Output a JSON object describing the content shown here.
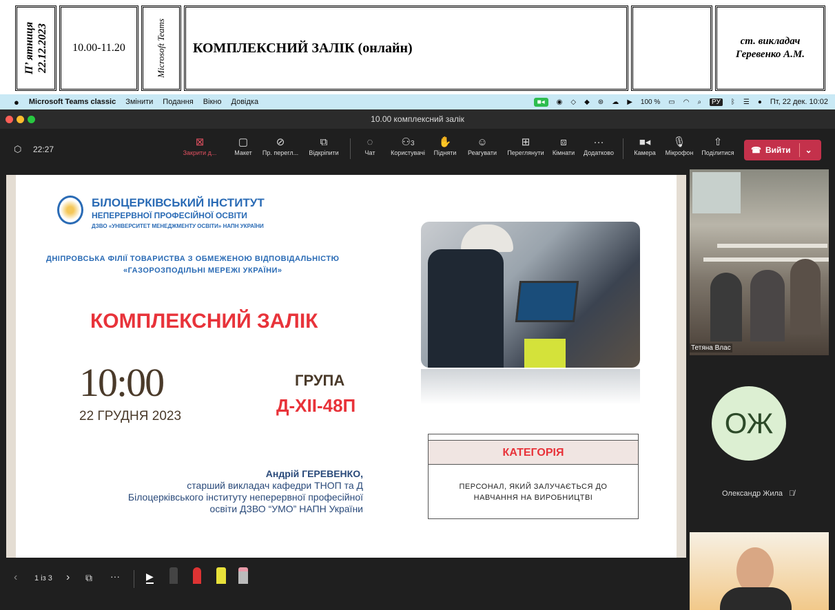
{
  "schedule": {
    "day": "П’ ятниця",
    "date": "22.12.2023",
    "time": "10.00-11.20",
    "platform": "Microsoft Teams",
    "subject": "КОМПЛЕКСНИЙ ЗАЛІК (онлайн)",
    "teacher_role": "ст. викладач",
    "teacher_name": "Геревенко А.М."
  },
  "menubar": {
    "app": "Microsoft Teams classic",
    "items": [
      "Змінити",
      "Подання",
      "Вікно",
      "Довідка"
    ],
    "battery": "100 %",
    "keyboard": "РУ",
    "datetime": "Пт, 22 дек. 10:02"
  },
  "window": {
    "title": "10.00 комплексний залік"
  },
  "toolbar": {
    "timer": "22:27",
    "buttons": [
      {
        "label": "Закрити д...",
        "icon": "close-share-icon"
      },
      {
        "label": "Макет",
        "icon": "layout-icon"
      },
      {
        "label": "Пр. перегл...",
        "icon": "hide-icon"
      },
      {
        "label": "Відкріпити",
        "icon": "popout-icon"
      },
      {
        "label": "Чат",
        "icon": "chat-icon"
      },
      {
        "label": "Користувачі",
        "icon": "people-icon",
        "count": "3"
      },
      {
        "label": "Підняти",
        "icon": "hand-icon"
      },
      {
        "label": "Реагувати",
        "icon": "smile-icon"
      },
      {
        "label": "Переглянути",
        "icon": "view-icon"
      },
      {
        "label": "Кімнати",
        "icon": "rooms-icon"
      },
      {
        "label": "Додатково",
        "icon": "more-icon"
      },
      {
        "label": "Камера",
        "icon": "camera-icon"
      },
      {
        "label": "Мікрофон",
        "icon": "mic-icon"
      },
      {
        "label": "Поділитися",
        "icon": "share-icon"
      }
    ],
    "leave": "Вийти"
  },
  "slide": {
    "inst_line1": "БІЛОЦЕРКІВСЬКИЙ ІНСТИТУТ",
    "inst_line2": "НЕПЕРЕРВНОЇ ПРОФЕСІЙНОЇ ОСВІТИ",
    "inst_line3": "ДЗВО «УНІВЕРСИТЕТ МЕНЕДЖМЕНТУ ОСВІТИ» НАПН УКРАЇНИ",
    "org_line1": "ДНІПРОВСЬКА ФІЛІЇ ТОВАРИСТВА З ОБМЕЖЕНОЮ ВІДПОВІДАЛЬНІСТЮ",
    "org_line2": "«ГАЗОРОЗПОДІЛЬНІ МЕРЕЖІ УКРАЇНИ»",
    "title": "КОМПЛЕКСНИЙ ЗАЛІК",
    "time": "10:00",
    "date": "22 ГРУДНЯ 2023",
    "group_label": "ГРУПА",
    "group": "Д-ХІІ-48П",
    "category_label": "КАТЕГОРІЯ",
    "category_text1": "ПЕРСОНАЛ, ЯКИЙ ЗАЛУЧАЄТЬСЯ ДО",
    "category_text2": "НАВЧАННЯ НА ВИРОБНИЦТВІ",
    "author_name": "Андрій ГЕРЕВЕНКО,",
    "author_line1": "старший викладач кафедри ТНОП та Д",
    "author_line2": "Білоцерківського інституту неперервної професійної",
    "author_line3": "освіти ДЗВО “УМО” НАПН України"
  },
  "participants": {
    "p1": "Тетяна Влас",
    "p2_initials": "ОЖ",
    "p2": "Олександр Жила"
  },
  "bottombar": {
    "page": "1 із 3"
  },
  "colors": {
    "accent_red": "#e8333a",
    "brown": "#4a3a2a",
    "blue": "#2a6bb5",
    "leave": "#c4314b"
  }
}
